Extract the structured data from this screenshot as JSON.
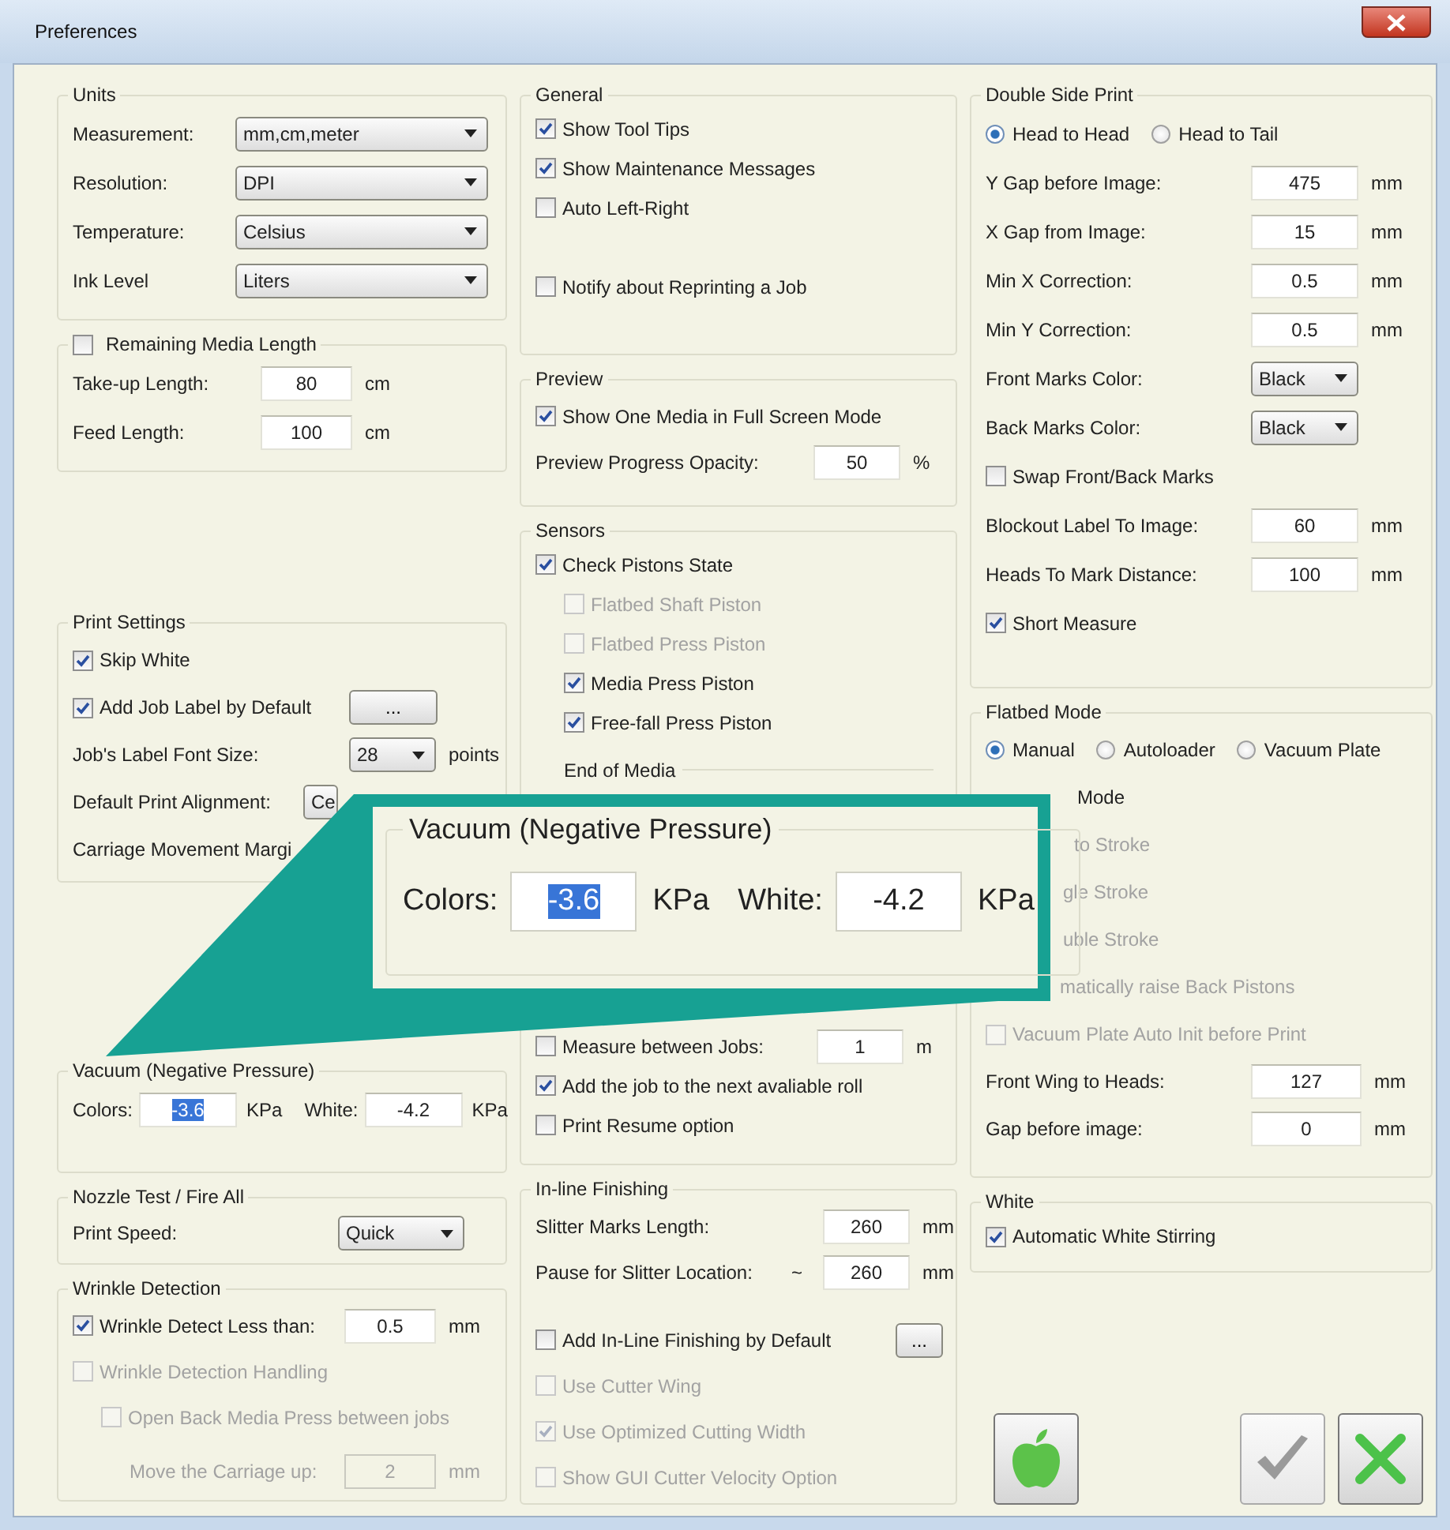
{
  "window": {
    "title": "Preferences"
  },
  "columns": [
    {
      "groups": [
        {
          "title": "Units",
          "rows": [
            {
              "kind": "combo",
              "label": "Measurement:",
              "value": "mm,cm,meter"
            },
            {
              "kind": "combo",
              "label": "Resolution:",
              "value": "DPI"
            },
            {
              "kind": "combo",
              "label": "Temperature:",
              "value": "Celsius"
            },
            {
              "kind": "combo",
              "label": "Ink Level",
              "value": "Liters"
            }
          ]
        },
        {
          "title": "Remaining Media Length",
          "checked": false,
          "rows": [
            {
              "kind": "field",
              "label": "Take-up Length:",
              "value": "80",
              "unit": "cm"
            },
            {
              "kind": "field",
              "label": "Feed Length:",
              "value": "100",
              "unit": "cm"
            }
          ]
        },
        {
          "title": "Print Settings",
          "rows": [
            {
              "kind": "check",
              "label": "Skip White",
              "checked": true
            },
            {
              "kind": "check_button",
              "label": "Add Job Label by Default",
              "checked": true,
              "button": "..."
            },
            {
              "kind": "combo",
              "label": "Job's Label Font Size:",
              "value": "28",
              "unit": "points"
            },
            {
              "kind": "combo",
              "label": "Default Print Alignment:",
              "value": "Ce"
            },
            {
              "kind": "fragment",
              "label": "Carriage Movement Margi",
              "disabled": false
            }
          ]
        },
        {
          "title": "Vacuum (Negative Pressure)",
          "rows": [
            {
              "kind": "fields_inline",
              "items": [
                {
                  "label": "Colors:",
                  "value": "-3.6",
                  "unit": "KPa",
                  "highlighted": true
                },
                {
                  "label": "White:",
                  "value": "-4.2",
                  "unit": "KPa",
                  "highlighted": false
                }
              ]
            }
          ]
        },
        {
          "title": "Nozzle Test / Fire All",
          "rows": [
            {
              "kind": "combo",
              "label": "Print Speed:",
              "value": "Quick"
            }
          ]
        },
        {
          "title": "Wrinkle Detection",
          "rows": [
            {
              "kind": "check_field",
              "label": "Wrinkle Detect Less than:",
              "checked": true,
              "value": "0.5",
              "unit": "mm"
            },
            {
              "kind": "check",
              "label": "Wrinkle Detection Handling",
              "checked": false,
              "disabled": true,
              "children": [
                {
                  "kind": "check",
                  "label": "Open Back Media Press between jobs",
                  "checked": false,
                  "disabled": true,
                  "children": [
                    {
                      "kind": "field",
                      "label": "Move the Carriage up:",
                      "value": "2",
                      "unit": "mm",
                      "disabled": true
                    }
                  ]
                }
              ]
            }
          ]
        }
      ]
    },
    {
      "groups": [
        {
          "title": "General",
          "rows": [
            {
              "kind": "check",
              "label": "Show Tool Tips",
              "checked": true
            },
            {
              "kind": "check",
              "label": "Show Maintenance Messages",
              "checked": true
            },
            {
              "kind": "check",
              "label": "Auto Left-Right",
              "checked": false
            },
            {
              "kind": "check",
              "label": "Notify about Reprinting a Job",
              "checked": false
            }
          ]
        },
        {
          "title": "Preview",
          "rows": [
            {
              "kind": "check",
              "label": "Show One Media in Full Screen Mode",
              "checked": true
            },
            {
              "kind": "field",
              "label": "Preview Progress Opacity:",
              "value": "50",
              "unit": "%"
            }
          ]
        },
        {
          "title": "Sensors",
          "rows": [
            {
              "kind": "check",
              "label": "Check Pistons State",
              "checked": true,
              "children": [
                {
                  "kind": "check",
                  "label": "Flatbed Shaft Piston",
                  "checked": false,
                  "disabled": true
                },
                {
                  "kind": "check",
                  "label": "Flatbed Press Piston",
                  "checked": false,
                  "disabled": true
                },
                {
                  "kind": "check",
                  "label": "Media Press Piston",
                  "checked": true
                },
                {
                  "kind": "check",
                  "label": "Free-fall Press Piston",
                  "checked": true
                }
              ]
            },
            {
              "kind": "subgroup",
              "label": "End of Media",
              "rows": [
                {
                  "kind": "check_field",
                  "label": "Measure between Jobs:",
                  "checked": false,
                  "value": "1",
                  "unit": "m"
                },
                {
                  "kind": "check",
                  "label": "Add the job to the next avaliable roll",
                  "checked": true
                },
                {
                  "kind": "check",
                  "label": "Print Resume option",
                  "checked": false
                }
              ]
            }
          ]
        },
        {
          "title": "In-line Finishing",
          "rows": [
            {
              "kind": "field",
              "label": "Slitter Marks Length:",
              "value": "260",
              "unit": "mm"
            },
            {
              "kind": "field",
              "label": "Pause for Slitter Location:",
              "prefix": "~",
              "value": "260",
              "unit": "mm"
            },
            {
              "kind": "check_button",
              "label": "Add In-Line Finishing by Default",
              "checked": false,
              "button": "..."
            },
            {
              "kind": "check",
              "label": "Use Cutter Wing",
              "checked": false,
              "disabled": true
            },
            {
              "kind": "check",
              "label": "Use Optimized Cutting Width",
              "checked": true,
              "disabled": true
            },
            {
              "kind": "check",
              "label": "Show GUI Cutter Velocity Option",
              "checked": false,
              "disabled": true
            }
          ]
        }
      ]
    },
    {
      "groups": [
        {
          "title": "Double Side Print",
          "rows": [
            {
              "kind": "radios",
              "options": [
                {
                  "label": "Head to Head",
                  "selected": true
                },
                {
                  "label": "Head to Tail",
                  "selected": false
                }
              ]
            },
            {
              "kind": "field",
              "label": "Y Gap before Image:",
              "value": "475",
              "unit": "mm"
            },
            {
              "kind": "field",
              "label": "X Gap from Image:",
              "value": "15",
              "unit": "mm"
            },
            {
              "kind": "field",
              "label": "Min X Correction:",
              "value": "0.5",
              "unit": "mm"
            },
            {
              "kind": "field",
              "label": "Min Y Correction:",
              "value": "0.5",
              "unit": "mm"
            },
            {
              "kind": "combo",
              "label": "Front Marks Color:",
              "value": "Black"
            },
            {
              "kind": "combo",
              "label": "Back Marks Color:",
              "value": "Black"
            },
            {
              "kind": "check",
              "label": "Swap Front/Back Marks",
              "checked": false
            },
            {
              "kind": "field",
              "label": "Blockout Label To Image:",
              "value": "60",
              "unit": "mm"
            },
            {
              "kind": "field",
              "label": "Heads To Mark Distance:",
              "value": "100",
              "unit": "mm"
            },
            {
              "kind": "check",
              "label": "Short Measure",
              "checked": true
            }
          ]
        },
        {
          "title": "Flatbed Mode",
          "rows": [
            {
              "kind": "radios",
              "options": [
                {
                  "label": "Manual",
                  "selected": true
                },
                {
                  "label": "Autoloader",
                  "selected": false
                },
                {
                  "label": "Vacuum Plate",
                  "selected": false
                }
              ]
            },
            {
              "kind": "fragment",
              "label": "Mode",
              "disabled": false
            },
            {
              "kind": "fragment",
              "label": "to Stroke",
              "disabled": true
            },
            {
              "kind": "fragment",
              "label": "gle Stroke",
              "disabled": true
            },
            {
              "kind": "fragment",
              "label": "uble Stroke",
              "disabled": true
            },
            {
              "kind": "fragment",
              "label": "matically raise Back Pistons",
              "disabled": true
            },
            {
              "kind": "check",
              "label": "Vacuum Plate Auto Init before Print",
              "checked": false,
              "disabled": true
            },
            {
              "kind": "field",
              "label": "Front Wing to Heads:",
              "value": "127",
              "unit": "mm"
            },
            {
              "kind": "field",
              "label": "Gap before image:",
              "value": "0",
              "unit": "mm"
            }
          ]
        },
        {
          "title": "White",
          "rows": [
            {
              "kind": "check",
              "label": "Automatic White Stirring",
              "checked": true
            }
          ]
        }
      ]
    }
  ],
  "buttons": [
    {
      "kind": "apple",
      "disabled": false
    },
    {
      "kind": "ok",
      "disabled": true
    },
    {
      "kind": "cancel",
      "disabled": false
    }
  ],
  "callout": {
    "title": "Vacuum (Negative Pressure)",
    "items": [
      {
        "label": "Colors:",
        "value": "-3.6",
        "unit": "KPa",
        "highlighted": true
      },
      {
        "label": "White:",
        "value": "-4.2",
        "unit": "KPa",
        "highlighted": false
      }
    ]
  }
}
